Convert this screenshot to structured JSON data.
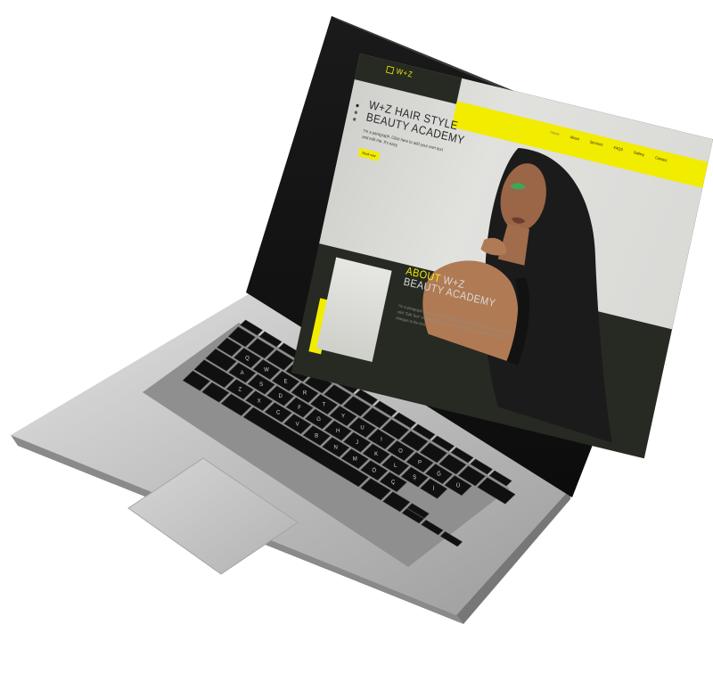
{
  "site": {
    "logo": "W+Z",
    "hero": {
      "title_line1": "W+Z HAIR STYLE",
      "title_line2": "BEAUTY ACADEMY",
      "subtitle": "I'm a paragraph. Click here to add your own text and edit me. It's easy.",
      "cta_label": "Book now"
    },
    "nav": [
      "Home",
      "About",
      "Services",
      "FAQS",
      "Gallery",
      "Contact"
    ],
    "about": {
      "title_highlight": "ABOUT",
      "title_rest": " W+Z",
      "title_line2": "BEAUTY ACADEMY",
      "text": "I'm a paragraph. Click here to add your own text and edit me. It's easy. Just click \"Edit Text\" or double click me to add your own content and make changes to the font."
    }
  },
  "keyboard": {
    "row1": [
      "Q",
      "W",
      "E",
      "R",
      "T",
      "Y",
      "U",
      "I",
      "O",
      "P",
      "Ğ",
      "Ü"
    ],
    "row2": [
      "A",
      "S",
      "D",
      "F",
      "G",
      "H",
      "J",
      "K",
      "L",
      "Ş",
      "İ"
    ],
    "row3": [
      "Z",
      "X",
      "C",
      "V",
      "B",
      "N",
      "M",
      "Ö",
      "Ç"
    ]
  },
  "colors": {
    "accent": "#f2ec00",
    "site_dark": "#262a22",
    "laptop_silver": "#c9c9c9"
  }
}
